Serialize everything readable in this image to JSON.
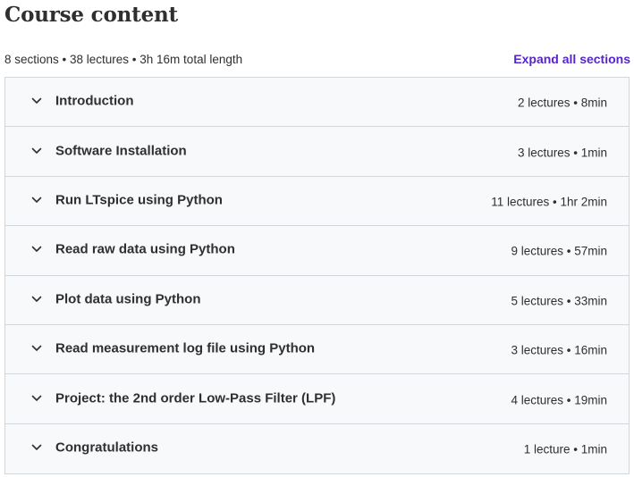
{
  "header": {
    "title": "Course content"
  },
  "summary": {
    "text": "8 sections • 38 lectures • 3h 16m total length",
    "expand_all_label": "Expand all sections"
  },
  "sections": [
    {
      "title": "Introduction",
      "meta": "2 lectures • 8min",
      "icon": "chevron-down-icon"
    },
    {
      "title": "Software Installation",
      "meta": "3 lectures • 1min",
      "icon": "chevron-down-icon"
    },
    {
      "title": "Run LTspice using Python",
      "meta": "11 lectures • 1hr 2min",
      "icon": "chevron-down-icon"
    },
    {
      "title": "Read raw data using Python",
      "meta": "9 lectures • 57min",
      "icon": "chevron-down-icon"
    },
    {
      "title": "Plot data using Python",
      "meta": "5 lectures • 33min",
      "icon": "chevron-down-icon"
    },
    {
      "title": "Read measurement log file using Python",
      "meta": "3 lectures • 16min",
      "icon": "chevron-down-icon"
    },
    {
      "title": "Project: the 2nd order Low-Pass Filter (LPF)",
      "meta": "4 lectures • 19min",
      "icon": "chevron-down-icon"
    },
    {
      "title": "Congratulations",
      "meta": "1 lecture • 1min",
      "icon": "chevron-down-icon"
    }
  ],
  "colors": {
    "accent": "#5624d0",
    "text": "#2d2f31",
    "section_bg": "#f7f9fa",
    "border": "#d1d7dc"
  }
}
